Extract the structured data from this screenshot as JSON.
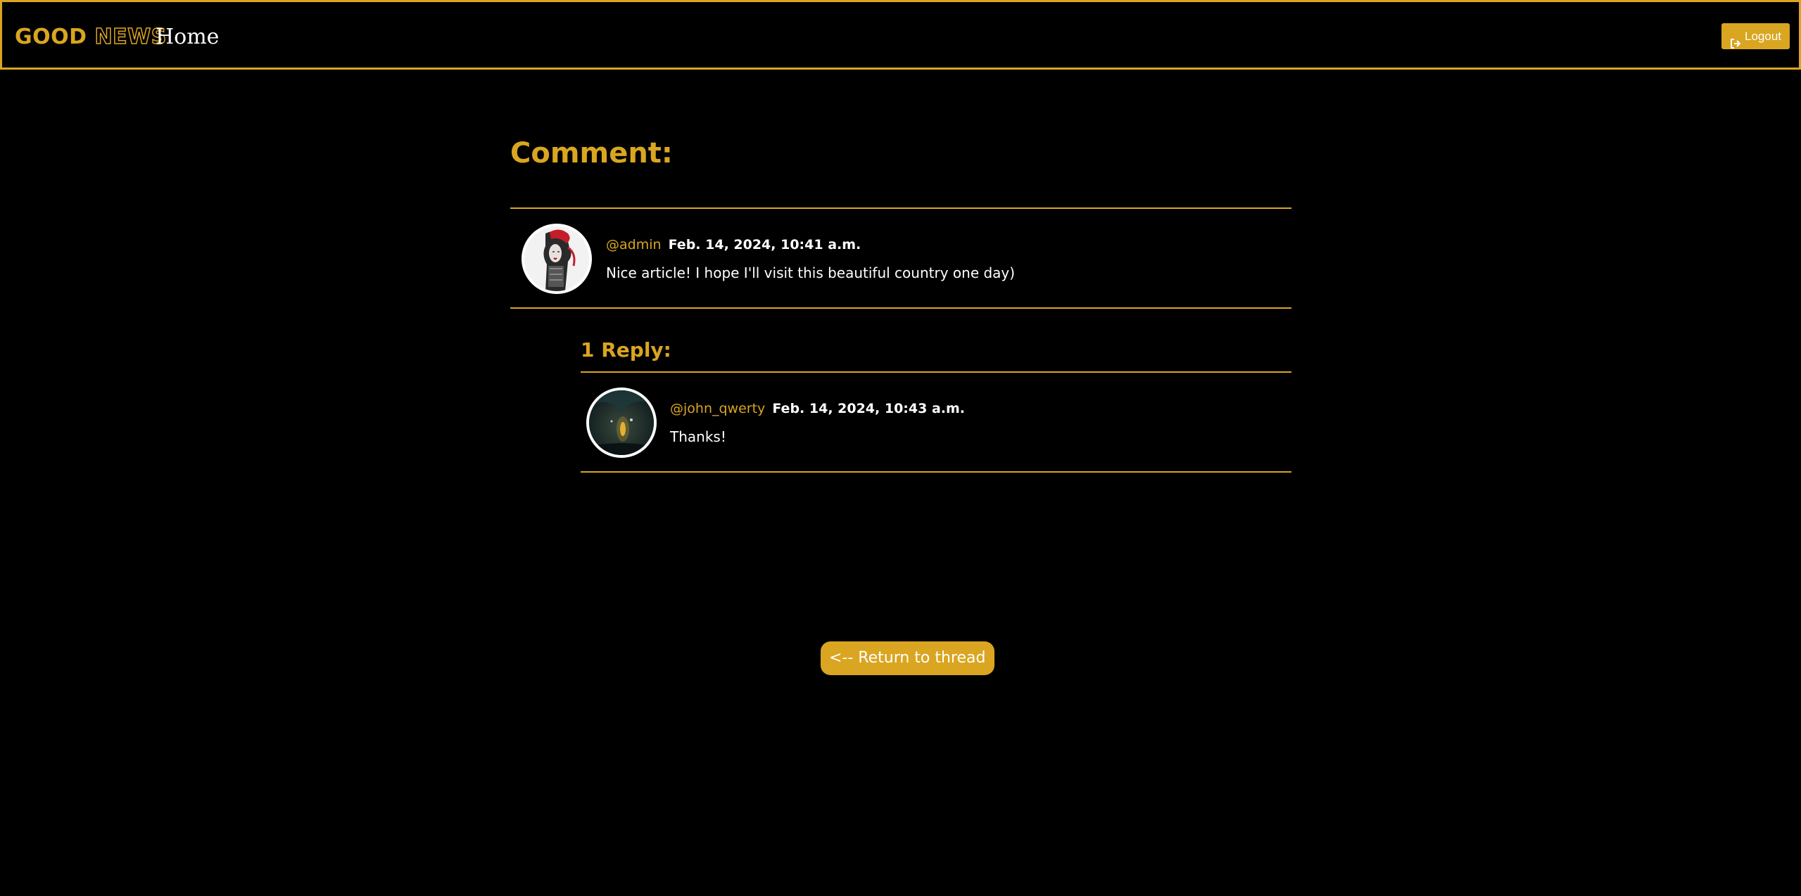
{
  "navbar": {
    "brand_good": "GOOD",
    "brand_news": "NEWS",
    "home_label": "Home",
    "logout_label": "Logout",
    "logout_icon": "sign-out-icon"
  },
  "main": {
    "heading": "Comment:",
    "comment": {
      "username": "@admin",
      "date": "Feb. 14, 2024, 10:41 a.m.",
      "text": "Nice article! I hope I'll visit this beautiful country one day)"
    },
    "replies_heading": "1 Reply:",
    "replies": [
      {
        "username": "@john_qwerty",
        "date": "Feb. 14, 2024, 10:43 a.m.",
        "text": "Thanks!"
      }
    ],
    "return_label": "<-- Return to thread"
  },
  "colors": {
    "accent": "#DAA520",
    "background": "#000000",
    "text": "#FFFFFF"
  }
}
